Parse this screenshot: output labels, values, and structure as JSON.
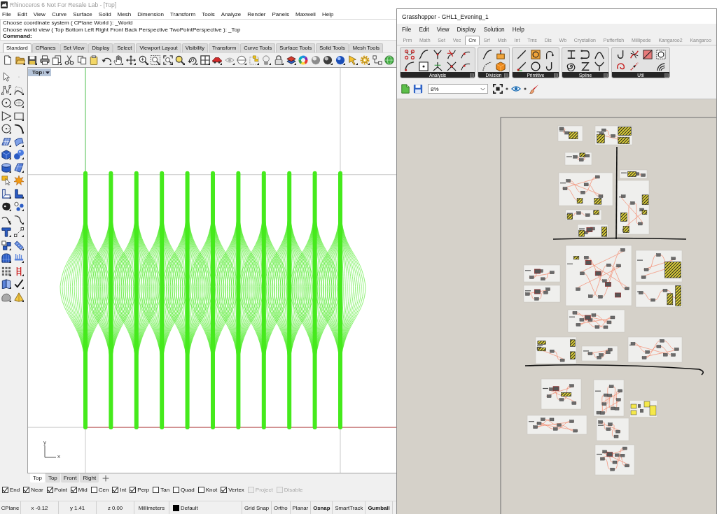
{
  "rhino": {
    "title": "Rhinoceros 6 Not For Resale Lab - [Top]",
    "menu": [
      "File",
      "Edit",
      "View",
      "Curve",
      "Surface",
      "Solid",
      "Mesh",
      "Dimension",
      "Transform",
      "Tools",
      "Analyze",
      "Render",
      "Panels",
      "Maxwell",
      "Help"
    ],
    "command_history": [
      "Choose coordinate system ( CPlane World ): _World",
      "Choose world view ( Top Bottom Left Right Front Back Perspective TwoPointPerspective ): _Top"
    ],
    "command_prompt": "Command:",
    "toolbar_tabs": [
      {
        "label": "Standard",
        "selected": true
      },
      {
        "label": "CPlanes",
        "selected": false
      },
      {
        "label": "Set View",
        "selected": false
      },
      {
        "label": "Display",
        "selected": false
      },
      {
        "label": "Select",
        "selected": false
      },
      {
        "label": "Viewport Layout",
        "selected": false
      },
      {
        "label": "Visibility",
        "selected": false
      },
      {
        "label": "Transform",
        "selected": false
      },
      {
        "label": "Curve Tools",
        "selected": false
      },
      {
        "label": "Surface Tools",
        "selected": false
      },
      {
        "label": "Solid Tools",
        "selected": false
      },
      {
        "label": "Mesh Tools",
        "selected": false
      }
    ],
    "viewport": {
      "title": "Top",
      "y_axis_label": "y",
      "x_axis_label": "x"
    },
    "viewport_tabs": [
      {
        "label": "Top",
        "selected": true
      },
      {
        "label": "Top",
        "selected": false
      },
      {
        "label": "Front",
        "selected": false
      },
      {
        "label": "Right",
        "selected": false
      }
    ],
    "osnaps": [
      {
        "label": "End",
        "checked": true,
        "disabled": false
      },
      {
        "label": "Near",
        "checked": true,
        "disabled": false
      },
      {
        "label": "Point",
        "checked": true,
        "disabled": false
      },
      {
        "label": "Mid",
        "checked": true,
        "disabled": false
      },
      {
        "label": "Cen",
        "checked": false,
        "disabled": false
      },
      {
        "label": "Int",
        "checked": true,
        "disabled": false
      },
      {
        "label": "Perp",
        "checked": true,
        "disabled": false
      },
      {
        "label": "Tan",
        "checked": false,
        "disabled": false
      },
      {
        "label": "Quad",
        "checked": false,
        "disabled": false
      },
      {
        "label": "Knot",
        "checked": false,
        "disabled": false
      },
      {
        "label": "Vertex",
        "checked": true,
        "disabled": false
      },
      {
        "label": "Project",
        "checked": false,
        "disabled": true
      },
      {
        "label": "Disable",
        "checked": false,
        "disabled": true
      }
    ],
    "status_bar": {
      "cplane": "CPlane",
      "x": "x -0.12",
      "y": "y 1.41",
      "z": "z 0.00",
      "units": "Millimeters",
      "layer": {
        "name": "Default",
        "color": "#000000"
      },
      "toggles": [
        {
          "label": "Grid Snap",
          "on": false
        },
        {
          "label": "Ortho",
          "on": false
        },
        {
          "label": "Planar",
          "on": false
        },
        {
          "label": "Osnap",
          "on": true
        },
        {
          "label": "SmartTrack",
          "on": false
        },
        {
          "label": "Gumball",
          "on": true
        }
      ]
    }
  },
  "grasshopper": {
    "title": "Grasshopper - GHL1_Evening_1",
    "menu": [
      "File",
      "Edit",
      "View",
      "Display",
      "Solution",
      "Help"
    ],
    "tabs": [
      {
        "label": "Prm",
        "selected": false
      },
      {
        "label": "Math",
        "selected": false
      },
      {
        "label": "Set",
        "selected": false
      },
      {
        "label": "Vec",
        "selected": false
      },
      {
        "label": "Crv",
        "selected": true
      },
      {
        "label": "Srf",
        "selected": false
      },
      {
        "label": "Msh",
        "selected": false
      },
      {
        "label": "Int",
        "selected": false
      },
      {
        "label": "Trns",
        "selected": false
      },
      {
        "label": "Dis",
        "selected": false
      },
      {
        "label": "Wb",
        "selected": false
      },
      {
        "label": "Crystallon",
        "selected": false
      },
      {
        "label": "Pufferfish",
        "selected": false
      },
      {
        "label": "Millipede",
        "selected": false
      },
      {
        "label": "Kangaroo2",
        "selected": false
      },
      {
        "label": "Kangaroo",
        "selected": false
      }
    ],
    "panels": [
      "Analysis",
      "Division",
      "Primitive",
      "Spline",
      "Util"
    ],
    "zoom": "8%"
  }
}
